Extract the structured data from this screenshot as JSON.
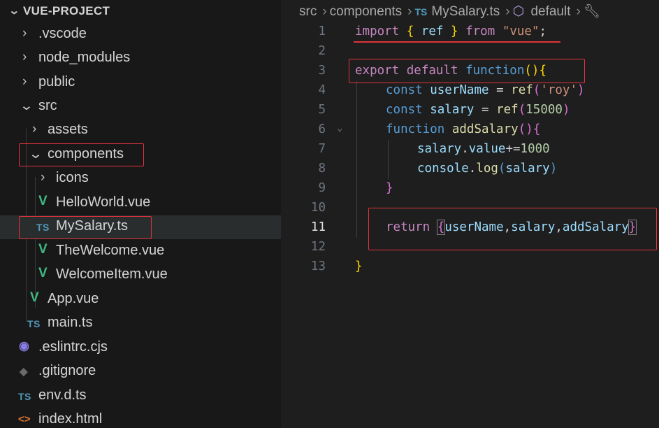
{
  "explorer": {
    "project_title": "VUE-PROJECT",
    "items": [
      {
        "label": ".vscode"
      },
      {
        "label": "node_modules"
      },
      {
        "label": "public"
      },
      {
        "label": "src"
      },
      {
        "label": "assets"
      },
      {
        "label": "components"
      },
      {
        "label": "icons"
      },
      {
        "label": "HelloWorld.vue"
      },
      {
        "label": "MySalary.ts",
        "selected": true
      },
      {
        "label": "TheWelcome.vue"
      },
      {
        "label": "WelcomeItem.vue"
      },
      {
        "label": "App.vue"
      },
      {
        "label": "main.ts"
      },
      {
        "label": ".eslintrc.cjs"
      },
      {
        "label": ".gitignore"
      },
      {
        "label": "env.d.ts"
      },
      {
        "label": "index.html"
      }
    ],
    "ts_badge": "TS"
  },
  "breadcrumb": {
    "items": [
      "src",
      "components",
      "MySalary.ts",
      "default"
    ],
    "ts_badge": "TS"
  },
  "editor": {
    "line_numbers": [
      "1",
      "2",
      "3",
      "4",
      "5",
      "6",
      "7",
      "8",
      "9",
      "10",
      "11",
      "12",
      "13"
    ],
    "active_line": "11",
    "tokens": {
      "import": "import",
      "ref": "ref",
      "from": "from",
      "vue_str": "\"vue\"",
      "export": "export",
      "default": "default",
      "function": "function",
      "const": "const",
      "userName": "userName",
      "salary": "salary",
      "roy_str": "'roy'",
      "num15000": "15000",
      "addSalary": "addSalary",
      "value": "value",
      "num1000": "1000",
      "console": "console",
      "log": "log",
      "return": "return"
    }
  },
  "colors": {
    "annotation": "#e0343c",
    "ts": "#519aba",
    "vue": "#41b883"
  }
}
